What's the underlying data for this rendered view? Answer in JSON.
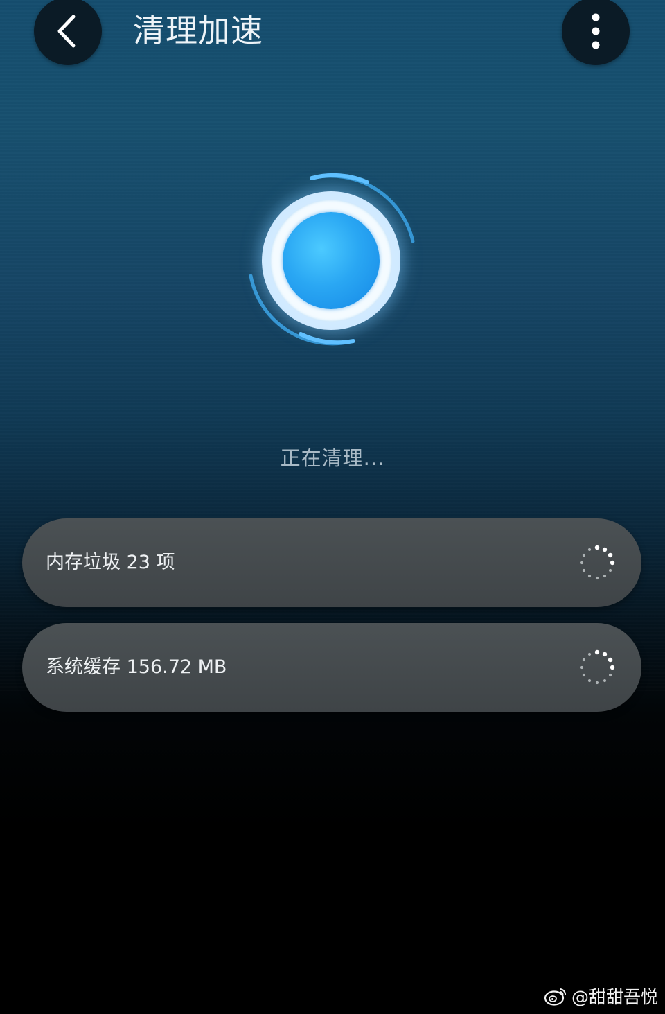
{
  "header": {
    "title": "清理加速",
    "back_icon": "chevron-left-icon",
    "more_icon": "more-vertical-icon"
  },
  "status": {
    "text": "正在清理..."
  },
  "items": [
    {
      "label": "内存垃圾 23 项",
      "icon": "loading-spinner-icon"
    },
    {
      "label": "系统缓存 156.72 MB",
      "icon": "loading-spinner-icon"
    }
  ],
  "watermark": {
    "text": "@甜甜吾悦",
    "icon": "weibo-logo-icon"
  },
  "colors": {
    "accent": "#2aa7f3",
    "orb_glow": "#cfe9ff",
    "card_bg": "#464b4e",
    "header_button_bg": "#0b1b26"
  }
}
